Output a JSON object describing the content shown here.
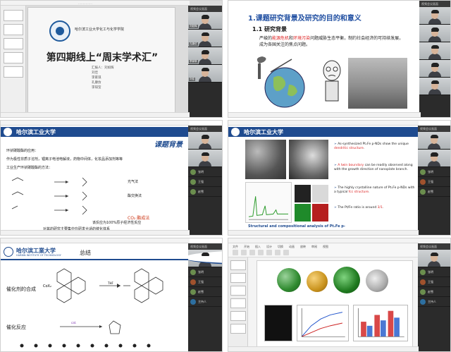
{
  "panel1": {
    "title": "第四期线上“周末学术汇”",
    "university": "哈尔滨工业大学化工与化学学院",
    "hosts": [
      "汇报人：刘如辉",
      "刘佳",
      "李家琪",
      "孔康仿",
      "李琪莹"
    ]
  },
  "panel2": {
    "section_title": "1.课题研究背景及研究的目的和意义",
    "sub_title": "1.1  研究背景",
    "text_before": "严峻的",
    "text_red1": "能源危机",
    "text_mid": "和",
    "text_red2": "环境污染",
    "text_after": "问题威胁生态平衡，制约社会经济的可持续发展，成为各国关注的焦点问题。"
  },
  "panel3": {
    "banner": "哈尔滨工业大学",
    "topic": "课题背景",
    "line1": "环状碳酸酯的应用：",
    "line2": "作为极性非质子溶剂，锂离子电池电解液，药物中间体，化妆品添加剂等等",
    "line3": "工业生产环状碳酸酯的方法：",
    "r1": "光气法",
    "r2": "酯交换法",
    "co2": "CO₂ 酯成法",
    "foot1": "该反应为100%原子经济性反应",
    "foot2": "对其的研究主要集中在研发合适的催化体系"
  },
  "panel4": {
    "banner": "哈尔滨工业大学",
    "caption": "Structural and compositional analysis of PtₓFe p-",
    "bullets": [
      {
        "a": "As-synthesized PtₓFe p-NDs show the unique ",
        "red": "dendritic structure",
        "b": "."
      },
      {
        "a": "",
        "red": "A twin boundary",
        "b": " can be readily observed along with the growth direction of nanoplate branch."
      },
      {
        "a": "The highly crystalline nature of PtₓFe p-NDs with a typical ",
        "red": "fcc structure",
        "b": "."
      },
      {
        "a": "The Pt/Fe ratio is around ",
        "red": "3/1",
        "b": "."
      }
    ]
  },
  "panel5": {
    "banner": "哈尔滨工業大学",
    "banner_sub": "HARBIN INSTITUTE OF TECHNOLOGY",
    "summary": "总结",
    "label1": "催化剂的合成",
    "label2": "催化反应",
    "reagent": "CoX₂",
    "condition": "THF"
  },
  "panel6": {
    "tabs": [
      "文件",
      "开始",
      "插入",
      "设计",
      "切换",
      "动画",
      "放映",
      "审阅",
      "视图"
    ]
  },
  "participants": {
    "strip_title": "视频会议画面",
    "names": [
      "主持人",
      "刘如辉",
      "孔康仿",
      "李家琪",
      "刘佳"
    ],
    "audio_only": [
      "张明",
      "王强",
      "赵雪"
    ]
  }
}
